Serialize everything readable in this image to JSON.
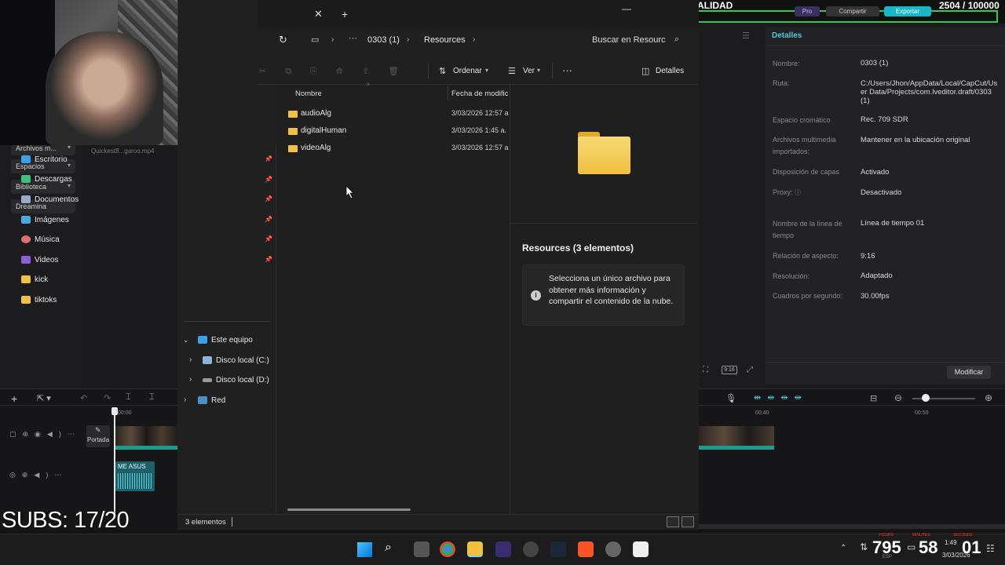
{
  "overlay": {
    "subs": "SUBS: 17/20",
    "stream_title": "MEJORAR CALIDAD",
    "counter": "2504 / 100000"
  },
  "capcut": {
    "left_items": [
      "Archivos m...",
      "Espacios",
      "Biblioteca",
      "Dreamina"
    ],
    "media_file": "Quickest8...garoo.mp4",
    "top_buttons": {
      "pro": "Pro",
      "share": "Compartir",
      "export": "Exportar"
    },
    "cover_label": "Portada",
    "audio_clip": "ME ASUS",
    "timecode_left": "00:00",
    "timecode_mid": "00:40",
    "timecode_right": "00:50",
    "ratio_badge": "9:16",
    "details_header": "Detalles",
    "details": [
      {
        "label": "Nombre:",
        "value": "0303 (1)"
      },
      {
        "label": "Ruta:",
        "value": "C:/Users/Jhon/AppData/Local/CapCut/User Data/Projects/com.lveditor.draft/0303 (1)"
      },
      {
        "label": "Espacio cromático",
        "value": "Rec. 709 SDR"
      },
      {
        "label": "Archivos multimedia importados:",
        "value": "Mantener en la ubicación original"
      },
      {
        "label": "Disposición de capas",
        "value": "Activado"
      },
      {
        "label": "Proxy:",
        "value": "Desactivado"
      },
      {
        "label": "Nombre de la línea de tiempo",
        "value": "Línea de tiempo 01"
      },
      {
        "label": "Relación de aspecto:",
        "value": "9:16"
      },
      {
        "label": "Resolución:",
        "value": "Adaptado"
      },
      {
        "label": "Cuadros por segundo:",
        "value": "30.00fps"
      }
    ],
    "modify_button": "Modificar"
  },
  "explorer": {
    "breadcrumb": [
      "0303 (1)",
      "Resources"
    ],
    "search_placeholder": "Buscar en Resourc",
    "toolbar": {
      "sort": "Ordenar",
      "view": "Ver",
      "more": "···",
      "details": "Detalles"
    },
    "columns": {
      "name": "Nombre",
      "date": "Fecha de modific"
    },
    "files": [
      {
        "name": "audioAlg",
        "date": "3/03/2026 12:57 a"
      },
      {
        "name": "digitalHuman",
        "date": "3/03/2026 1:45 a."
      },
      {
        "name": "videoAlg",
        "date": "3/03/2026 12:57 a"
      }
    ],
    "nav_quick": [
      {
        "label": "Escritorio",
        "color": "#3aa0e8"
      },
      {
        "label": "Descargas",
        "color": "#3ec07a"
      },
      {
        "label": "Documentos",
        "color": "#9aa8c8"
      },
      {
        "label": "Imágenes",
        "color": "#4aa8e0"
      },
      {
        "label": "Música",
        "color": "#e07070"
      },
      {
        "label": "Videos",
        "color": "#8a60d8"
      },
      {
        "label": "kick",
        "color": "#f0c040"
      },
      {
        "label": "tiktoks",
        "color": "#f0c040"
      }
    ],
    "nav_pc": "Este equipo",
    "nav_drives": [
      "Disco local (C:)",
      "Disco local (D:)"
    ],
    "nav_network": "Red",
    "preview_title": "Resources (3 elementos)",
    "preview_info": "Selecciona un único archivo para obtener más información y compartir el contenido de la nube.",
    "status": "3 elementos"
  },
  "taskbar": {
    "time": "1:49",
    "date": "3/03/2026",
    "big_num_1": "795",
    "big_num_2": "58",
    "big_num_3": "01",
    "lang": "ESP",
    "small_labels": [
      "HOURS",
      "MINUTES",
      "SECONDS"
    ]
  }
}
